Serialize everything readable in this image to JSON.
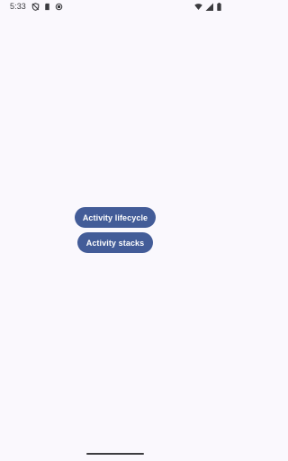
{
  "status_bar": {
    "time": "5:33",
    "left_icons": [
      "shield-off-icon",
      "sim-card-icon",
      "battery-saver-icon"
    ],
    "right_icons": [
      "wifi-icon",
      "signal-icon",
      "battery-icon"
    ]
  },
  "main": {
    "buttons": [
      {
        "label": "Activity lifecycle"
      },
      {
        "label": "Activity stacks"
      }
    ]
  },
  "colors": {
    "background": "#faf8fd",
    "button": "#435c98",
    "button_text": "#ffffff"
  }
}
